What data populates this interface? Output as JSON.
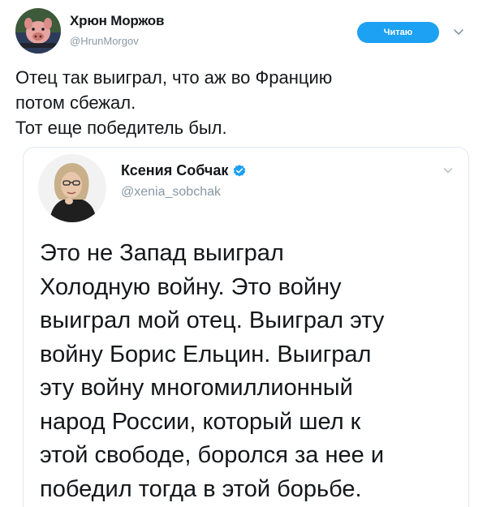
{
  "author": {
    "name": "Хрюн Моржов",
    "handle": "@HrunMorgov",
    "avatar_icon": "pig-avatar-icon"
  },
  "follow_button": {
    "label": "Читаю",
    "color": "#1da1f2"
  },
  "tweet": {
    "lines": [
      "Отец так выиграл, что аж во Францию",
      "потом сбежал.",
      "Тот еще победитель был."
    ]
  },
  "quoted": {
    "name": "Ксения Собчак",
    "handle": "@xenia_sobchak",
    "verified_icon": "verified-badge-icon",
    "lines": [
      "Это не Запад  выиграл",
      "Холодную войну. Это войну",
      "выиграл мой отец. Выиграл эту",
      "войну Борис Ельцин. Выиграл",
      "эту войну многомиллионный",
      "народ России, который шел к",
      "этой свободе, боролся за нее и",
      "победил тогда в этой борьбе."
    ]
  },
  "colors": {
    "text": "#14171a",
    "secondary": "#8899a6",
    "accent": "#1da1f2",
    "border": "#e1e8ed"
  }
}
